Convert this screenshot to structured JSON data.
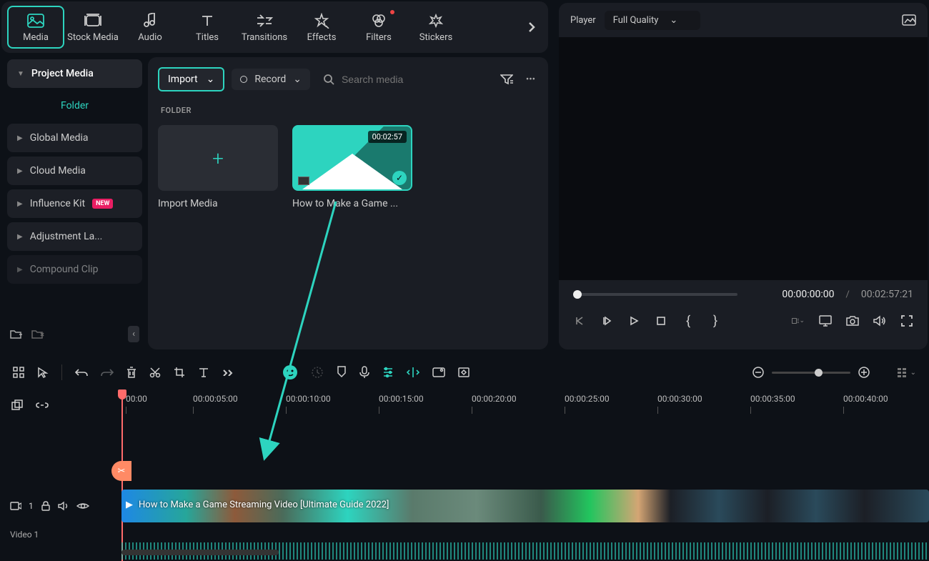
{
  "top_tabs": {
    "media": "Media",
    "stock_media": "Stock Media",
    "audio": "Audio",
    "titles": "Titles",
    "transitions": "Transitions",
    "effects": "Effects",
    "filters": "Filters",
    "stickers": "Stickers"
  },
  "sidebar": {
    "project_media": "Project Media",
    "folder": "Folder",
    "global_media": "Global Media",
    "cloud_media": "Cloud Media",
    "influence_kit": "Influence Kit",
    "influence_badge": "NEW",
    "adjustment_layers": "Adjustment La...",
    "compound_clip": "Compound Clip"
  },
  "media_toolbar": {
    "import": "Import",
    "record": "Record",
    "search_placeholder": "Search media"
  },
  "media_content": {
    "folder_label": "FOLDER",
    "import_card": "Import Media",
    "clip_name": "How to Make a Game ...",
    "clip_duration": "00:02:57"
  },
  "player": {
    "label": "Player",
    "quality": "Full Quality",
    "current_time": "00:00:00:00",
    "separator": "/",
    "duration": "00:02:57:21"
  },
  "timeline": {
    "ticks": [
      "00:00",
      "00:00:05:00",
      "00:00:10:00",
      "00:00:15:00",
      "00:00:20:00",
      "00:00:25:00",
      "00:00:30:00",
      "00:00:35:00",
      "00:00:40:00"
    ],
    "track_count": "1",
    "track_name": "Video 1",
    "clip_title": "How to Make a Game Streaming Video [Ultimate Guide 2022]"
  }
}
